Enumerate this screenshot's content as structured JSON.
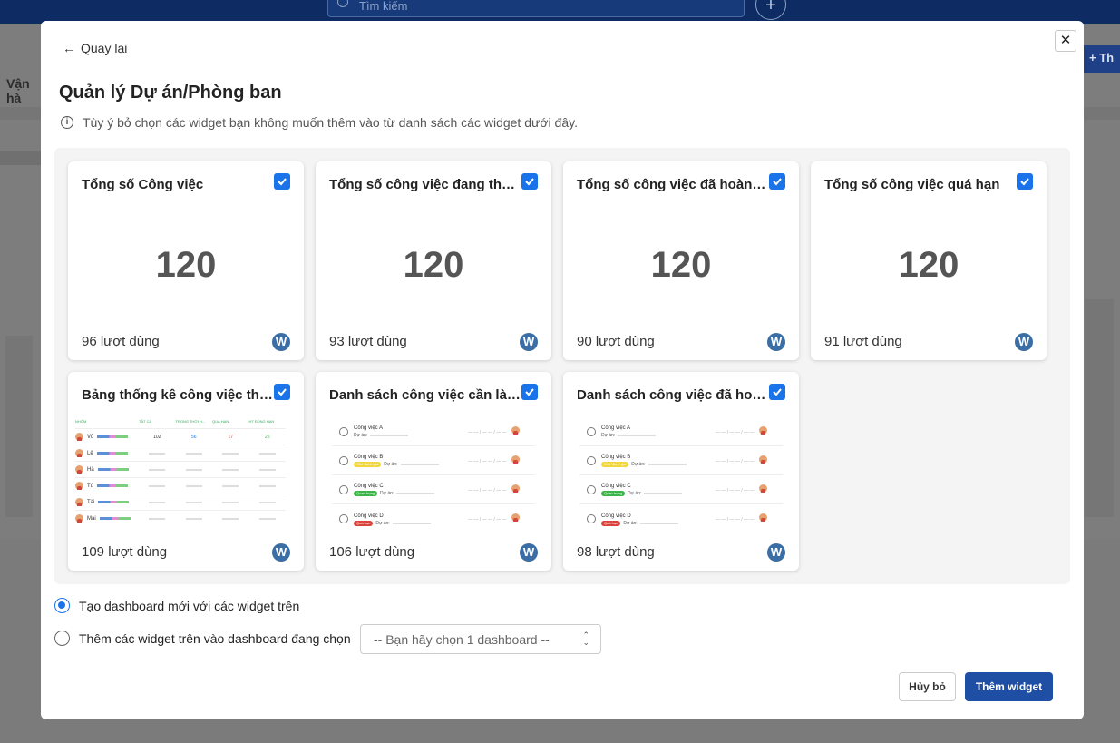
{
  "background": {
    "search_placeholder": "Tìm kiếm",
    "left_tab": "Vận hà",
    "right_button": "Th"
  },
  "modal": {
    "back_label": "Quay lại",
    "title": "Quản lý Dự án/Phòng ban",
    "hint": "Tùy ý bỏ chọn các widget bạn không muốn thêm vào từ danh sách các widget dưới đây.",
    "close_symbol": "✕"
  },
  "widgets": [
    {
      "title": "Tổng số Công việc",
      "value": "120",
      "uses": "96 lượt dùng",
      "checked": true
    },
    {
      "title": "Tổng số công việc đang thực hiện",
      "value": "120",
      "uses": "93 lượt dùng",
      "checked": true
    },
    {
      "title": "Tổng số công việc đã hoàn thành",
      "value": "120",
      "uses": "90 lượt dùng",
      "checked": true
    },
    {
      "title": "Tổng số công việc quá hạn",
      "value": "120",
      "uses": "91 lượt dùng",
      "checked": true
    },
    {
      "title": "Bảng thống kê công việc theo nhóm",
      "uses": "109 lượt dùng",
      "checked": true
    },
    {
      "title": "Danh sách công việc cần làm hôm nay",
      "uses": "106 lượt dùng",
      "checked": true
    },
    {
      "title": "Danh sách công việc đã hoàn thành",
      "uses": "98 lượt dùng",
      "checked": true
    }
  ],
  "table_preview": {
    "headers": [
      "NHÓM",
      "TẤT CẢ",
      "TRONG THỜI H...",
      "QUÁ HẠN",
      "HT ĐÚNG HẠN"
    ],
    "rows": [
      {
        "name": "Vũ",
        "n1": "102",
        "n2": "56",
        "n3": "17",
        "n4": "25"
      },
      {
        "name": "Lê"
      },
      {
        "name": "Hà"
      },
      {
        "name": "Tú"
      },
      {
        "name": "Tài"
      },
      {
        "name": "Mai"
      }
    ]
  },
  "task_preview": {
    "project_label": "Dự án:",
    "tasks": [
      {
        "name": "Công việc A",
        "tag": ""
      },
      {
        "name": "Công việc B",
        "tag": "Chờ đánh giá",
        "tag_color": "#f2d63c"
      },
      {
        "name": "Công việc C",
        "tag": "Quan trọng",
        "tag_color": "#3bb54a"
      },
      {
        "name": "Công việc D",
        "tag": "Quá hạn",
        "tag_color": "#d9423a"
      }
    ]
  },
  "logo_letter": "W",
  "options": {
    "new_dashboard": "Tạo dashboard mới với các widget trên",
    "existing_dashboard": "Thêm các widget trên vào dashboard đang chọn",
    "select_placeholder": "-- Bạn hãy chọn 1 dashboard --",
    "selected": "new_dashboard"
  },
  "buttons": {
    "cancel": "Hủy bỏ",
    "add": "Thêm widget"
  },
  "colors": {
    "primary": "#1a73e8",
    "button_primary": "#1f4fa5",
    "topbar": "#0e2c63"
  }
}
